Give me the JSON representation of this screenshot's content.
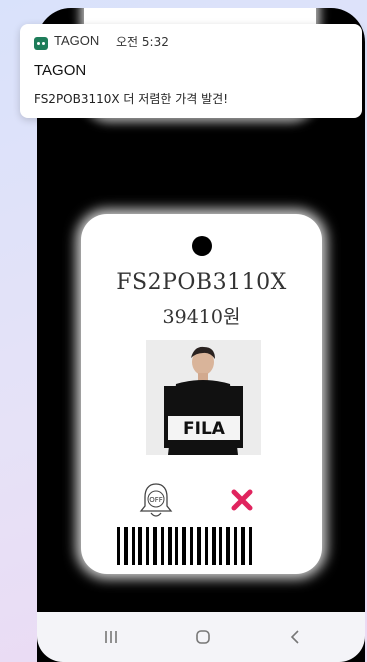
{
  "notification": {
    "app_name": "TAGON",
    "time": "오전 5:32",
    "title": "TAGON",
    "message": "FS2POB3110X 더 저렴한 가격 발견!",
    "icon": "app-icon"
  },
  "price_tag": {
    "product_code": "FS2POB3110X",
    "price": "39410원",
    "product_image": "product-photo",
    "photo_print": "FILA",
    "alarm_icon_label": "OFF",
    "alarm_icon": "alarm-off-icon",
    "delete_icon": "close-icon",
    "delete_color": "#e0245e",
    "barcode": "barcode"
  },
  "navigation": {
    "items": [
      {
        "icon": "recents-icon"
      },
      {
        "icon": "home-icon"
      },
      {
        "icon": "back-icon"
      }
    ]
  },
  "colors": {
    "background": "#000000",
    "tag": "#ffffff",
    "accent": "#e0245e"
  }
}
